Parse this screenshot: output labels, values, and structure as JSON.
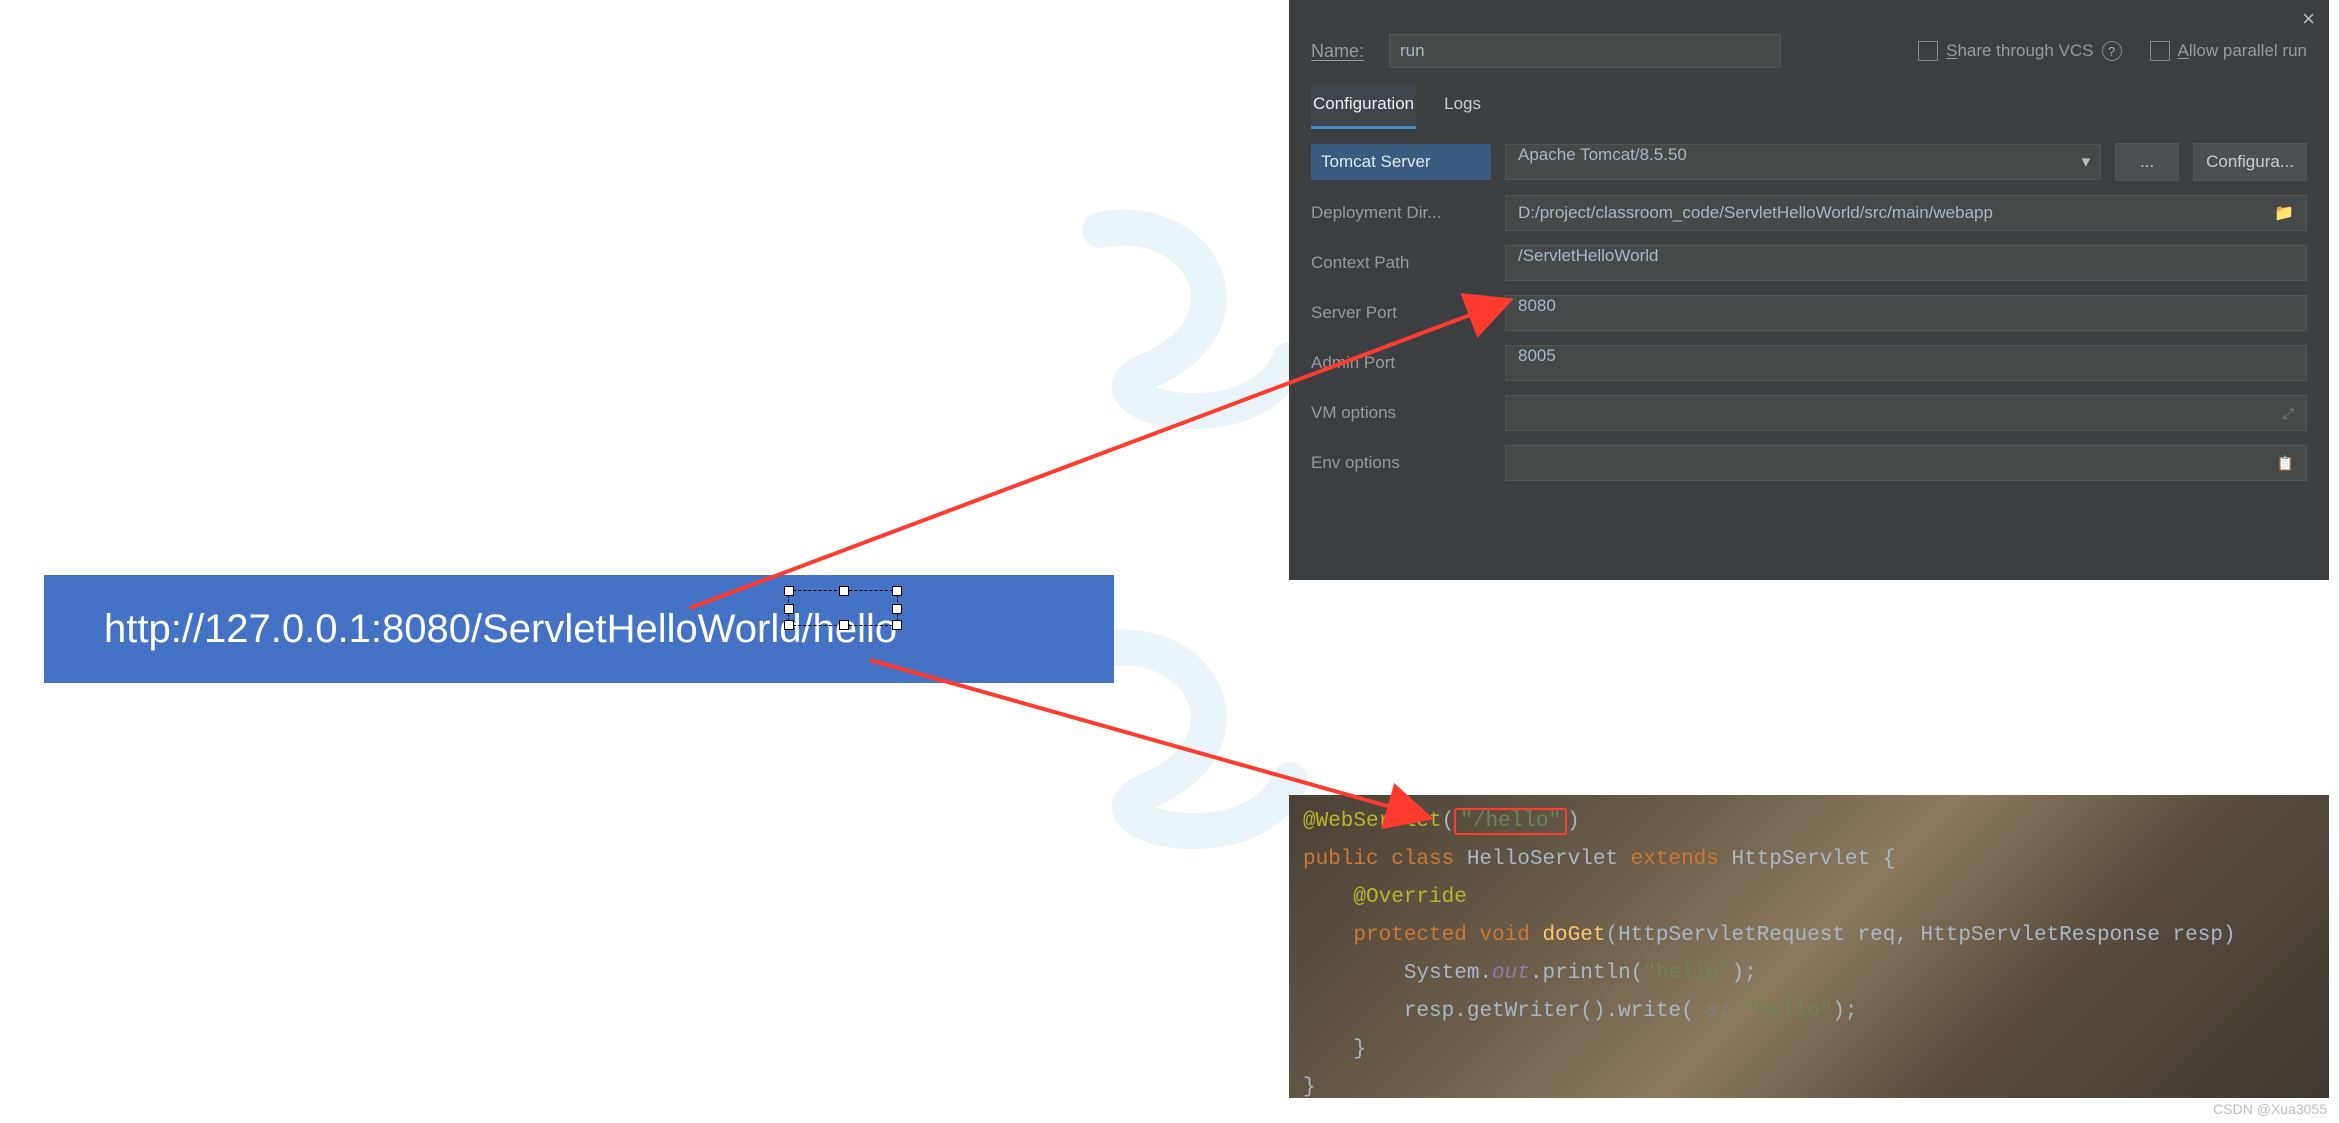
{
  "url_box": {
    "text": "http://127.0.0.1:8080/ServletHelloWorld/hello"
  },
  "dialog": {
    "close_glyph": "×",
    "name_label": "Name:",
    "name_value": "run",
    "share_label_pre": "S",
    "share_label_rest": "hare through VCS",
    "allow_label_pre": "A",
    "allow_label_rest": "llow parallel run",
    "tabs": {
      "config": "Configuration",
      "logs": "Logs"
    },
    "rows": {
      "server_label": "Tomcat Server",
      "server_value": "Apache Tomcat/8.5.50",
      "more_btn": "...",
      "config_btn": "Configura...",
      "deploy_label": "Deployment Dir...",
      "deploy_value": "D:/project/classroom_code/ServletHelloWorld/src/main/webapp",
      "context_label": "Context Path",
      "context_value": "/ServletHelloWorld",
      "port_label": "Server Port",
      "port_value": "8080",
      "admin_label": "Admin Port",
      "admin_value": "8005",
      "vm_label": "VM options",
      "vm_value": "",
      "env_label": "Env options",
      "env_value": ""
    }
  },
  "code": {
    "l1_ann": "@WebServlet",
    "l1_open": "(",
    "l1_str": "\"/hello\"",
    "l1_close": ")",
    "l2_kw1": "public class ",
    "l2_cls": "HelloServlet ",
    "l2_kw2": "extends ",
    "l2_sup": "HttpServlet {",
    "l3_ann": "@Override",
    "l4_kw": "protected void ",
    "l4_mtd": "doGet",
    "l4_sig": "(HttpServletRequest req, HttpServletResponse resp)",
    "l5_pre": "System.",
    "l5_fld": "out",
    "l5_post": ".println(",
    "l5_str": "\"hello\"",
    "l5_end": ");",
    "l6_pre": "resp.getWriter().write( ",
    "l6_par": "s: ",
    "l6_str": "\"hello\"",
    "l6_end": ");",
    "l7": "}",
    "l8": "}"
  },
  "credit": "CSDN @Xua3055"
}
